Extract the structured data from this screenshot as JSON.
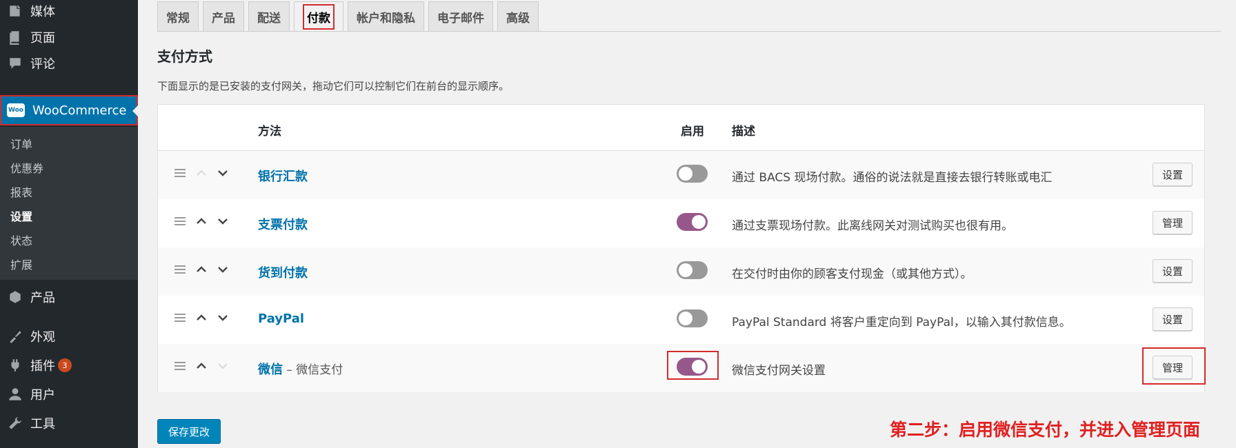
{
  "sidebar": {
    "items": [
      {
        "label": "媒体",
        "icon": "media-icon"
      },
      {
        "label": "页面",
        "icon": "pages-icon"
      },
      {
        "label": "评论",
        "icon": "comments-icon"
      }
    ],
    "woocommerce": {
      "label": "WooCommerce",
      "logo_text": "Woo"
    },
    "submenu": [
      "订单",
      "优惠券",
      "报表",
      "设置",
      "状态",
      "扩展"
    ],
    "current_submenu": "设置",
    "lower_items": [
      {
        "label": "产品",
        "icon": "products-icon"
      },
      {
        "label": "外观",
        "icon": "appearance-icon"
      },
      {
        "label": "插件",
        "icon": "plugins-icon",
        "badge": "3"
      },
      {
        "label": "用户",
        "icon": "users-icon"
      },
      {
        "label": "工具",
        "icon": "tools-icon"
      }
    ]
  },
  "tabs": [
    "常规",
    "产品",
    "配送",
    "付款",
    "帐户和隐私",
    "电子邮件",
    "高级"
  ],
  "active_tab": "付款",
  "section": {
    "title": "支付方式",
    "description": "下面显示的是已安装的支付网关，拖动它们可以控制它们在前台的显示顺序。"
  },
  "table": {
    "headers": {
      "method": "方法",
      "enabled": "启用",
      "description": "描述"
    },
    "rows": [
      {
        "name": "银行汇款",
        "extra": "",
        "enabled": false,
        "description": "通过 BACS 现场付款。通俗的说法就是直接去银行转账或电汇",
        "action": "设置",
        "up_disabled": true,
        "down_disabled": false
      },
      {
        "name": "支票付款",
        "extra": "",
        "enabled": true,
        "description": "通过支票现场付款。此离线网关对测试购买也很有用。",
        "action": "管理",
        "up_disabled": false,
        "down_disabled": false
      },
      {
        "name": "货到付款",
        "extra": "",
        "enabled": false,
        "description": "在交付时由你的顾客支付现金（或其他方式）。",
        "action": "设置",
        "up_disabled": false,
        "down_disabled": false
      },
      {
        "name": "PayPal",
        "extra": "",
        "enabled": false,
        "description": "PayPal Standard 将客户重定向到 PayPal，以输入其付款信息。",
        "action": "设置",
        "up_disabled": false,
        "down_disabled": false
      },
      {
        "name": "微信",
        "extra": " – 微信支付",
        "enabled": true,
        "description": "微信支付网关设置",
        "action": "管理",
        "up_disabled": false,
        "down_disabled": true
      }
    ]
  },
  "save_button": "保存更改",
  "annotation": "第二步：启用微信支付，并进入管理页面",
  "colors": {
    "sidebar_bg": "#23282d",
    "accent_blue": "#0073aa",
    "toggle_on": "#96588a",
    "highlight_red": "#d42a2a",
    "annotation_red": "#e02020"
  }
}
